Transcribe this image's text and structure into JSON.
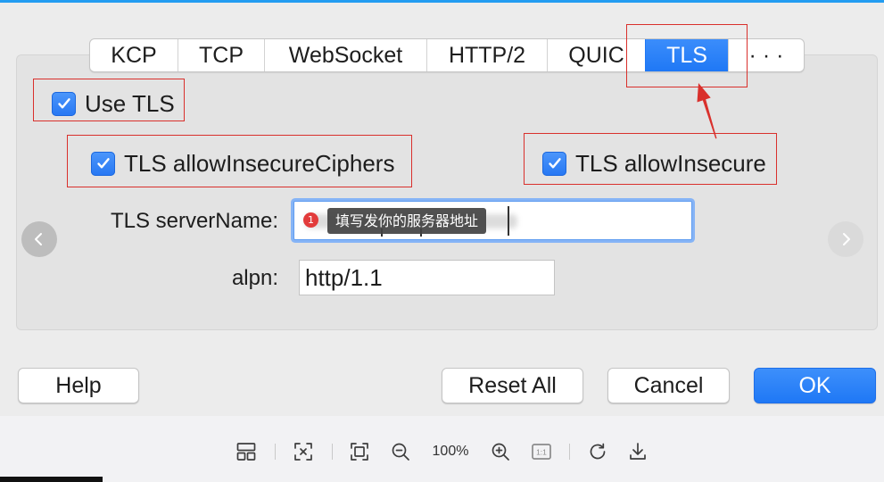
{
  "colors": {
    "accent": "#1f78f5",
    "annotation": "#d9302c"
  },
  "tabs": [
    {
      "label": "KCP"
    },
    {
      "label": "TCP"
    },
    {
      "label": "WebSocket"
    },
    {
      "label": "HTTP/2"
    },
    {
      "label": "QUIC"
    },
    {
      "label": "TLS",
      "selected": true
    },
    {
      "label": "···"
    }
  ],
  "options": {
    "use_tls": {
      "label": "Use TLS",
      "checked": true
    },
    "allow_insecure_ciphers": {
      "label": "TLS allowInsecureCiphers",
      "checked": true
    },
    "allow_insecure": {
      "label": "TLS allowInsecure",
      "checked": true
    }
  },
  "fields": {
    "server_name": {
      "label": "TLS serverName:",
      "annotation_badge": "1",
      "annotation_tooltip": "填写发你的服务器地址"
    },
    "alpn": {
      "label": "alpn:",
      "value": "http/1.1"
    }
  },
  "nav": {
    "prev_icon": "chevron-left-icon",
    "next_icon": "chevron-right-icon"
  },
  "buttons": {
    "help": "Help",
    "reset_all": "Reset All",
    "cancel": "Cancel",
    "ok": "OK"
  },
  "viewer_toolbar": {
    "zoom": "100%",
    "actual_size_label": "1:1",
    "icons": [
      "layout-icon",
      "exit-fullscreen-icon",
      "fit-screen-icon",
      "zoom-out-icon",
      "zoom-in-icon",
      "actual-size-icon",
      "rotate-icon",
      "download-icon"
    ]
  }
}
